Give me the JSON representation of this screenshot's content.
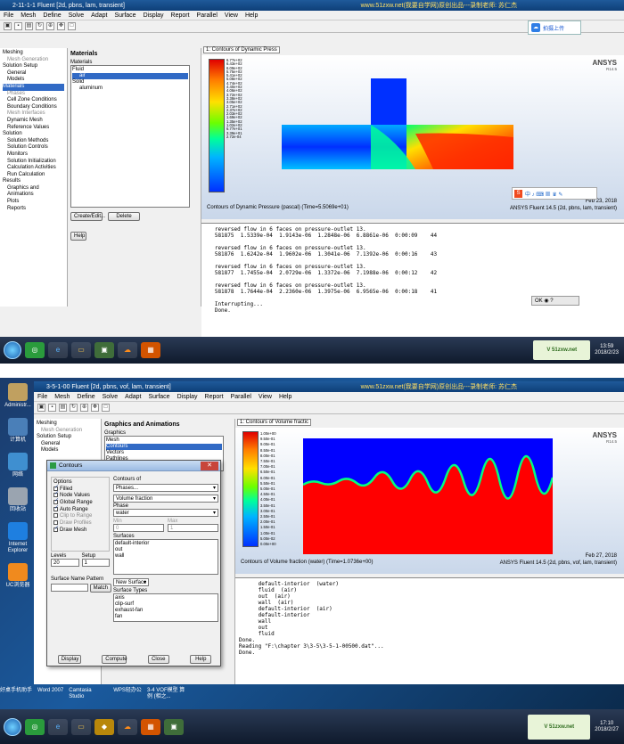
{
  "top": {
    "title": "2-11-1-1 Fluent [2d, pbns, lam, transient]",
    "watermark": "www.51zxw.net(我要自学网)原创出品---录制老师: 苏仁杰",
    "menu": [
      "File",
      "Mesh",
      "Define",
      "Solve",
      "Adapt",
      "Surface",
      "Display",
      "Report",
      "Parallel",
      "View",
      "Help"
    ],
    "tree": [
      {
        "t": "Meshing",
        "c": "g"
      },
      {
        "t": "Mesh Generation",
        "c": "d"
      },
      {
        "t": "Solution Setup",
        "c": "g"
      },
      {
        "t": "General",
        "c": "i"
      },
      {
        "t": "Models",
        "c": "i"
      },
      {
        "t": "Materials",
        "c": "sel"
      },
      {
        "t": "Phases",
        "c": "d"
      },
      {
        "t": "Cell Zone Conditions",
        "c": "i"
      },
      {
        "t": "Boundary Conditions",
        "c": "i"
      },
      {
        "t": "Mesh Interfaces",
        "c": "d"
      },
      {
        "t": "Dynamic Mesh",
        "c": "i"
      },
      {
        "t": "Reference Values",
        "c": "i"
      },
      {
        "t": "Solution",
        "c": "g"
      },
      {
        "t": "Solution Methods",
        "c": "i"
      },
      {
        "t": "Solution Controls",
        "c": "i"
      },
      {
        "t": "Monitors",
        "c": "i"
      },
      {
        "t": "Solution Initialization",
        "c": "i"
      },
      {
        "t": "Calculation Activities",
        "c": "i"
      },
      {
        "t": "Run Calculation",
        "c": "i"
      },
      {
        "t": "Results",
        "c": "g"
      },
      {
        "t": "Graphics and Animations",
        "c": "i"
      },
      {
        "t": "Plots",
        "c": "i"
      },
      {
        "t": "Reports",
        "c": "i"
      }
    ],
    "panel_title": "Materials",
    "materials_label": "Materials",
    "materials": [
      {
        "t": "Fluid",
        "c": ""
      },
      {
        "t": "air",
        "c": "sel"
      },
      {
        "t": "Solid",
        "c": ""
      },
      {
        "t": "aluminum",
        "c": "ind"
      }
    ],
    "create_edit": "Create/Edit...",
    "delete": "Delete",
    "help": "Help",
    "view_tab": "1: Contours of Dynamic Press",
    "logo": "ANSYS",
    "logo_ver": "R14.5",
    "ticks": [
      "6.77e+02",
      "6.43e+02",
      "6.09e+02",
      "5.75e+02",
      "5.41e+02",
      "5.08e+02",
      "4.74e+02",
      "4.40e+02",
      "4.06e+02",
      "3.72e+02",
      "3.38e+02",
      "3.05e+02",
      "2.71e+02",
      "2.37e+02",
      "2.03e+02",
      "1.69e+02",
      "1.35e+02",
      "1.02e+02",
      "6.77e+01",
      "3.39e+01",
      "2.72e-04"
    ],
    "caption": "Contours of Dynamic Pressure (pascal)  (Time=5.5069e+01)",
    "date": "Feb 23, 2018",
    "app_info": "ANSYS Fluent 14.5 (2d, pbns, lam, transient)",
    "console": [
      "   reversed flow in 6 faces on pressure-outlet 13.",
      "   581875  1.5339e-04  1.9143e-06  1.2848e-06  6.8861e-06  0:00:09    44",
      "",
      "   reversed flow in 6 faces on pressure-outlet 13.",
      "   581876  1.6242e-04  1.9602e-06  1.3041e-06  7.1392e-06  0:00:16    43",
      "",
      "   reversed flow in 6 faces on pressure-outlet 13.",
      "   581877  1.7455e-04  2.0729e-06  1.3372e-06  7.1988e-06  0:00:12    42",
      "",
      "   reversed flow in 6 faces on pressure-outlet 13.",
      "   581878  1.7644e-04  2.2360e-06  1.3975e-06  6.9565e-06  0:00:18    41",
      "",
      "   Interrupting...",
      "   Done."
    ],
    "clock_time": "13:59",
    "clock_date": "2018/2/23",
    "upload": "拍摄上传"
  },
  "bottom": {
    "title": "3-5-1-00 Fluent [2d, pbns, vof, lam, transient]",
    "watermark": "www.51zxw.net(我要自学网)原创出品---录制老师: 苏仁杰",
    "menu": [
      "File",
      "Mesh",
      "Define",
      "Solve",
      "Adapt",
      "Surface",
      "Display",
      "Report",
      "Parallel",
      "View",
      "Help"
    ],
    "desktop": [
      "Administr...",
      "计算机",
      "网络",
      "回收站",
      "Internet Explorer",
      "UC浏览器"
    ],
    "tree": [
      {
        "t": "Meshing",
        "c": "g"
      },
      {
        "t": "Mesh Generation",
        "c": "d"
      },
      {
        "t": "Solution Setup",
        "c": "g"
      },
      {
        "t": "General",
        "c": "i"
      },
      {
        "t": "Models",
        "c": "i"
      }
    ],
    "panel_title": "Graphics and Animations",
    "graphics_label": "Graphics",
    "graphics": [
      {
        "t": "Mesh",
        "c": ""
      },
      {
        "t": "Contours",
        "c": "sel"
      },
      {
        "t": "Vectors",
        "c": ""
      },
      {
        "t": "Pathlines",
        "c": ""
      },
      {
        "t": "Particle Tracks",
        "c": ""
      }
    ],
    "view_tab": "1: Contours of Volume fractic",
    "logo": "ANSYS",
    "logo_ver": "R14.5",
    "ticks": [
      "1.00e+00",
      "9.50e-01",
      "9.00e-01",
      "8.50e-01",
      "8.00e-01",
      "7.50e-01",
      "7.00e-01",
      "6.50e-01",
      "6.00e-01",
      "5.50e-01",
      "5.00e-01",
      "4.50e-01",
      "4.00e-01",
      "3.50e-01",
      "3.00e-01",
      "2.50e-01",
      "2.00e-01",
      "1.50e-01",
      "1.00e-01",
      "5.00e-02",
      "0.00e+00"
    ],
    "caption": "Contours of Volume fraction (water)  (Time=1.0736e+00)",
    "date": "Feb 27, 2018",
    "app_info": "ANSYS Fluent 14.5 (2d, pbns, vof, lam, transient)",
    "console": [
      "      default-interior  (water)",
      "      fluid  (air)",
      "      out  (air)",
      "      wall  (air)",
      "      default-interior  (air)",
      "      default-interior",
      "      wall",
      "      out",
      "      fluid",
      "Done.",
      "Reading \"F:\\chapter 3\\3-5\\3-5-1-00500.dat\"...",
      "Done."
    ],
    "taskbar": [
      "好桌手机助手",
      "Word 2007",
      "Camtasia Studio",
      "WPS轻办公",
      "3-4 VOF模型 算例 (相之..."
    ],
    "clock_time": "17:10",
    "clock_date": "2018/2/27",
    "dialog": {
      "title": "Contours",
      "options_label": "Options",
      "options": [
        {
          "t": "Filled",
          "on": true
        },
        {
          "t": "Node Values",
          "on": true
        },
        {
          "t": "Global Range",
          "on": true
        },
        {
          "t": "Auto Range",
          "on": true
        },
        {
          "t": "Clip to Range",
          "on": false
        },
        {
          "t": "Draw Profiles",
          "on": false
        },
        {
          "t": "Draw Mesh",
          "on": true
        }
      ],
      "contours_of": "Contours of",
      "phases": "Phases...",
      "volume_fraction": "Volume fraction",
      "phase_label": "Phase",
      "phase": "water",
      "min_label": "Min",
      "max_label": "Max",
      "min": "0",
      "max": "1",
      "levels_label": "Levels",
      "levels": "20",
      "setup_label": "Setup",
      "setup": "1",
      "surfaces_label": "Surfaces",
      "surfaces": [
        "default-interior",
        "out",
        "wall"
      ],
      "pattern_label": "Surface Name Pattern",
      "match": "Match",
      "new_surface": "New Surface",
      "types_label": "Surface Types",
      "types": [
        "axis",
        "clip-surf",
        "exhaust-fan",
        "fan"
      ],
      "display": "Display",
      "compute": "Compute",
      "close": "Close",
      "help": "Help"
    }
  },
  "colors": {
    "accent": "#316ac5",
    "title": "#0e3f78"
  }
}
